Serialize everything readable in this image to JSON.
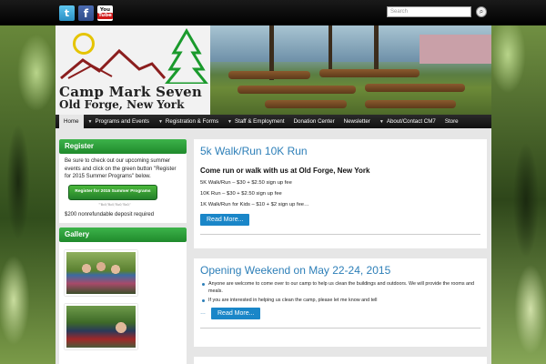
{
  "social": {
    "twitter": "t",
    "facebook": "f",
    "youtube_top": "You",
    "youtube_bottom": "Tube"
  },
  "search": {
    "placeholder": "Search",
    "button_icon": "⌕"
  },
  "logo": {
    "title": "Camp Mark Seven",
    "subtitle": "Old Forge, New York"
  },
  "nav": {
    "home": "Home",
    "items": [
      "Programs and Events",
      "Registration & Forms",
      "Staff & Employment",
      "Donation Center",
      "Newsletter",
      "About/Contact CM7",
      "Store"
    ]
  },
  "sidebar": {
    "register": {
      "title": "Register",
      "text": "Be sure to check out our upcoming summer events and click on the green button \"Register for 2015 Summer Programs\" below.",
      "button": "Register for 2015 Summer Programs",
      "fine": "\"\"Bc0;\"Bc0;\"Bc0;\"Bc0;\"",
      "deposit": "$200 nonrefundable deposit required"
    },
    "gallery": {
      "title": "Gallery"
    }
  },
  "posts": [
    {
      "title": "5k Walk/Run 10K Run",
      "subtitle": "Come run or walk with us at Old Forge, New York",
      "lines": [
        "5K Walk/Run – $30 + $2.50 sign up fee",
        "10K Run – $30 + $2.50 sign up fee",
        "1K Walk/Run for Kids – $10 + $2 sign up fee…"
      ],
      "more": "Read More..."
    },
    {
      "title": "Opening Weekend on May 22-24, 2015",
      "bullets": [
        "Anyone are welcome to come over to our camp to help us clean the buildings and outdoors. We will provide the rooms and meals.",
        "If you are interested in helping us clean the camp, please let me know and tell"
      ],
      "ellipsis": "…",
      "more": "Read More..."
    }
  ],
  "colors": {
    "accent_blue": "#2d7fb8",
    "widget_green": "#2a9a37",
    "nav_bg": "#1a1a1a"
  }
}
